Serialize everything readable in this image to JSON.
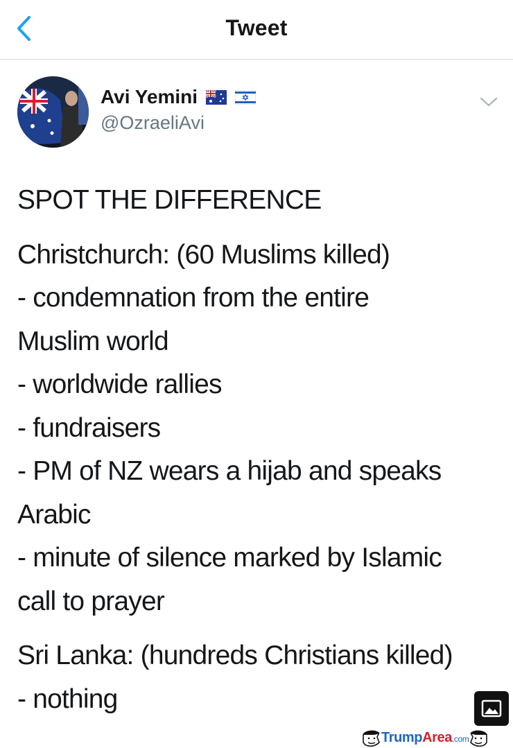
{
  "nav": {
    "title": "Tweet",
    "back_icon": "chevron-left-icon",
    "accent_color": "#1da1f2"
  },
  "author": {
    "display_name": "Avi Yemini",
    "handle": "@OzraeliAvi",
    "flags": [
      "australia-flag-icon",
      "israel-flag-icon"
    ]
  },
  "tweet": {
    "paragraphs": [
      {
        "lines": [
          "SPOT THE DIFFERENCE"
        ]
      },
      {
        "lines": [
          "Christchurch: (60 Muslims killed)",
          "- condemnation from the entire",
          "Muslim world",
          "- worldwide rallies",
          "- fundraisers",
          "- PM of NZ wears a hijab and speaks",
          "Arabic",
          "- minute of silence marked by Islamic",
          "call to prayer"
        ]
      },
      {
        "lines": [
          "Sri Lanka: (hundreds Christians killed)",
          "- nothing"
        ]
      }
    ]
  },
  "media_button_icon": "image-icon",
  "watermark": {
    "part1": "Trump",
    "part2": "Area",
    "part3": ".com"
  }
}
